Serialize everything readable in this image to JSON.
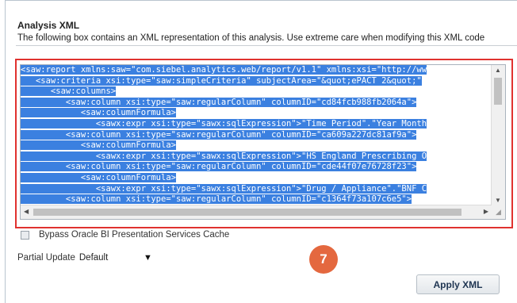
{
  "section": {
    "title": "Analysis XML",
    "description": "The following box contains an XML representation of this analysis. Use extreme care when modifying this XML code"
  },
  "xml_editor": {
    "lines": [
      "<saw:report xmlns:saw=\"com.siebel.analytics.web/report/v1.1\" xmlns:xsi=\"http://ww",
      "   <saw:criteria xsi:type=\"saw:simpleCriteria\" subjectArea=\"&quot;ePACT 2&quot;\"",
      "      <saw:columns>",
      "         <saw:column xsi:type=\"saw:regularColumn\" columnID=\"cd84fcb988fb2064a\">",
      "            <saw:columnFormula>",
      "               <sawx:expr xsi:type=\"sawx:sqlExpression\">\"Time Period\".\"Year Month",
      "         <saw:column xsi:type=\"saw:regularColumn\" columnID=\"ca609a227dc81af9a\">",
      "            <saw:columnFormula>",
      "               <sawx:expr xsi:type=\"sawx:sqlExpression\">\"HS England Prescribing O",
      "         <saw:column xsi:type=\"saw:regularColumn\" columnID=\"cde44f07e76728f23\">",
      "            <saw:columnFormula>",
      "               <sawx:expr xsi:type=\"sawx:sqlExpression\">\"Drug / Appliance\".\"BNF C",
      "         <saw:column xsi:type=\"saw:regularColumn\" columnID=\"c1364f73a107c6e5\">"
    ],
    "selection_color": "#3b80e0"
  },
  "options": {
    "bypass_cache_label": "Bypass Oracle BI Presentation Services Cache",
    "partial_update_label": "Partial Update",
    "partial_update_value": "Default"
  },
  "step_badge": {
    "number": "7",
    "color": "#e4683f"
  },
  "actions": {
    "apply_label": "Apply XML"
  },
  "accent": {
    "highlight_border": "#e0322f"
  }
}
